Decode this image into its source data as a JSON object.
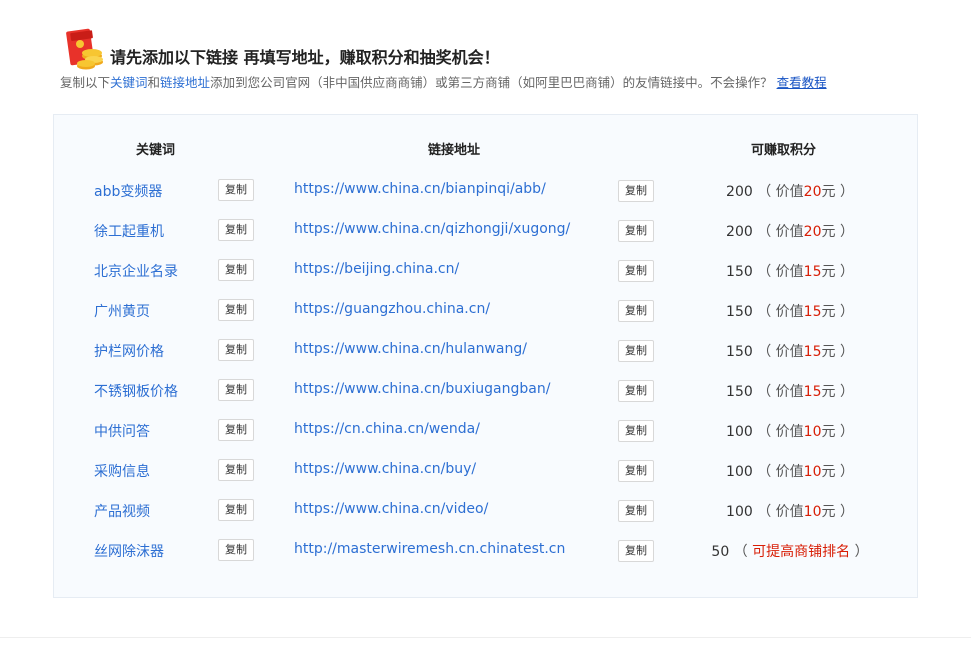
{
  "header": {
    "title": "请先添加以下链接 再填写地址，赚取积分和抽奖机会！",
    "subtitle_parts": {
      "p1": "复制以下",
      "kw1": "关键词",
      "p2": "和",
      "kw2": "链接地址",
      "p3": "添加到您公司官网（非中国供应商商铺）或第三方商铺（如阿里巴巴商铺）的友情链接中。不会操作？",
      "tutorial_link": "查看教程"
    },
    "icon": "red-envelope-coins-icon"
  },
  "table": {
    "headers": {
      "keyword": "关键词",
      "url": "链接地址",
      "points": "可赚取积分"
    },
    "copy_label": "复制",
    "rows": [
      {
        "keyword": "abb变频器",
        "url": "https://www.china.cn/bianpinqi/abb/",
        "points": "200",
        "note_prefix": "价值",
        "note_value": "20",
        "note_suffix": "元"
      },
      {
        "keyword": "徐工起重机",
        "url": "https://www.china.cn/qizhongji/xugong/",
        "points": "200",
        "note_prefix": "价值",
        "note_value": "20",
        "note_suffix": "元"
      },
      {
        "keyword": "北京企业名录",
        "url": "https://beijing.china.cn/",
        "points": "150",
        "note_prefix": "价值",
        "note_value": "15",
        "note_suffix": "元"
      },
      {
        "keyword": "广州黄页",
        "url": "https://guangzhou.china.cn/",
        "points": "150",
        "note_prefix": "价值",
        "note_value": "15",
        "note_suffix": "元"
      },
      {
        "keyword": "护栏网价格",
        "url": "https://www.china.cn/hulanwang/",
        "points": "150",
        "note_prefix": "价值",
        "note_value": "15",
        "note_suffix": "元"
      },
      {
        "keyword": "不锈钢板价格",
        "url": "https://www.china.cn/buxiugangban/",
        "points": "150",
        "note_prefix": "价值",
        "note_value": "15",
        "note_suffix": "元"
      },
      {
        "keyword": "中供问答",
        "url": "https://cn.china.cn/wenda/",
        "points": "100",
        "note_prefix": "价值",
        "note_value": "10",
        "note_suffix": "元"
      },
      {
        "keyword": "采购信息",
        "url": "https://www.china.cn/buy/",
        "points": "100",
        "note_prefix": "价值",
        "note_value": "10",
        "note_suffix": "元"
      },
      {
        "keyword": "产品视频",
        "url": "https://www.china.cn/video/",
        "points": "100",
        "note_prefix": "价值",
        "note_value": "10",
        "note_suffix": "元"
      },
      {
        "keyword": "丝网除沫器",
        "url": "http://masterwiremesh.cn.chinatest.cn",
        "points": "50",
        "note_red": "可提高商铺排名"
      }
    ]
  },
  "colors": {
    "link": "#2d6fd3",
    "accent_red": "#d81e06",
    "panel_bg": "#f8fbfe"
  }
}
